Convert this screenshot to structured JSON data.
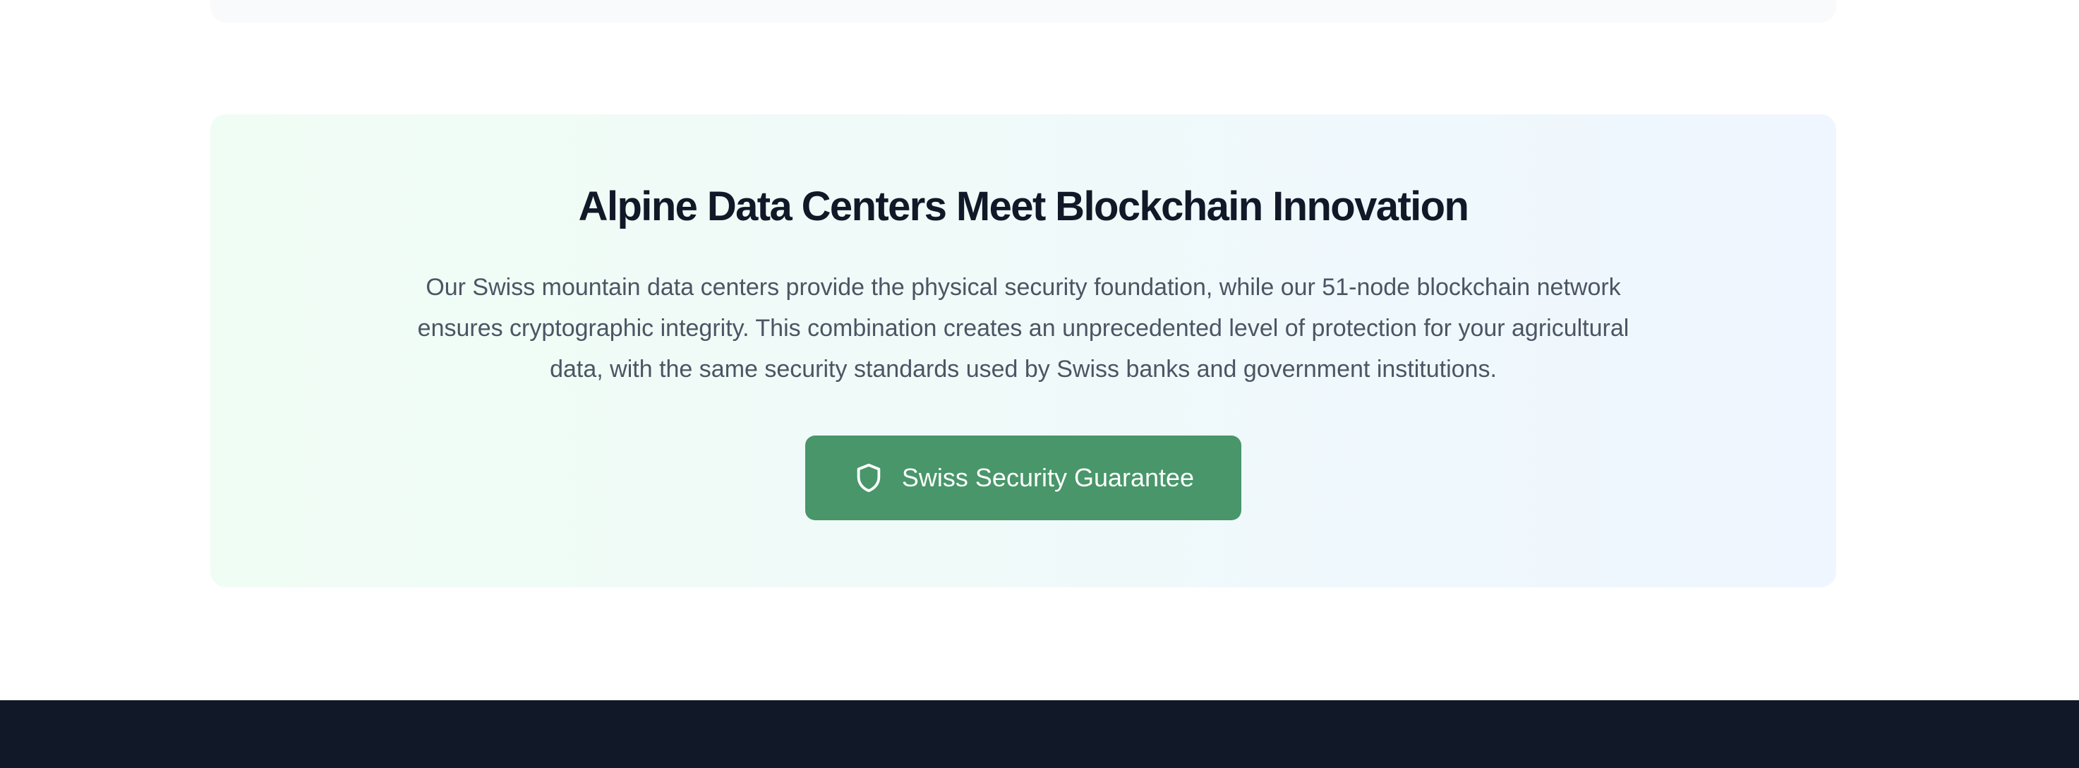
{
  "feature": {
    "title": "Alpine Data Centers Meet Blockchain Innovation",
    "body": "Our Swiss mountain data centers provide the physical security foundation, while our 51-node blockchain network ensures cryptographic integrity. This combination creates an unprecedented level of protection for your agricultural data, with the same security standards used by Swiss banks and government institutions.",
    "button": {
      "label": "Swiss Security Guarantee",
      "icon": "shield-icon"
    }
  },
  "colors": {
    "button_bg": "#48966a",
    "title": "#111827",
    "body_text": "#4b5563",
    "footer_bg": "#111827",
    "gradient_start": "#f0fdf4",
    "gradient_end": "#eff6ff"
  }
}
